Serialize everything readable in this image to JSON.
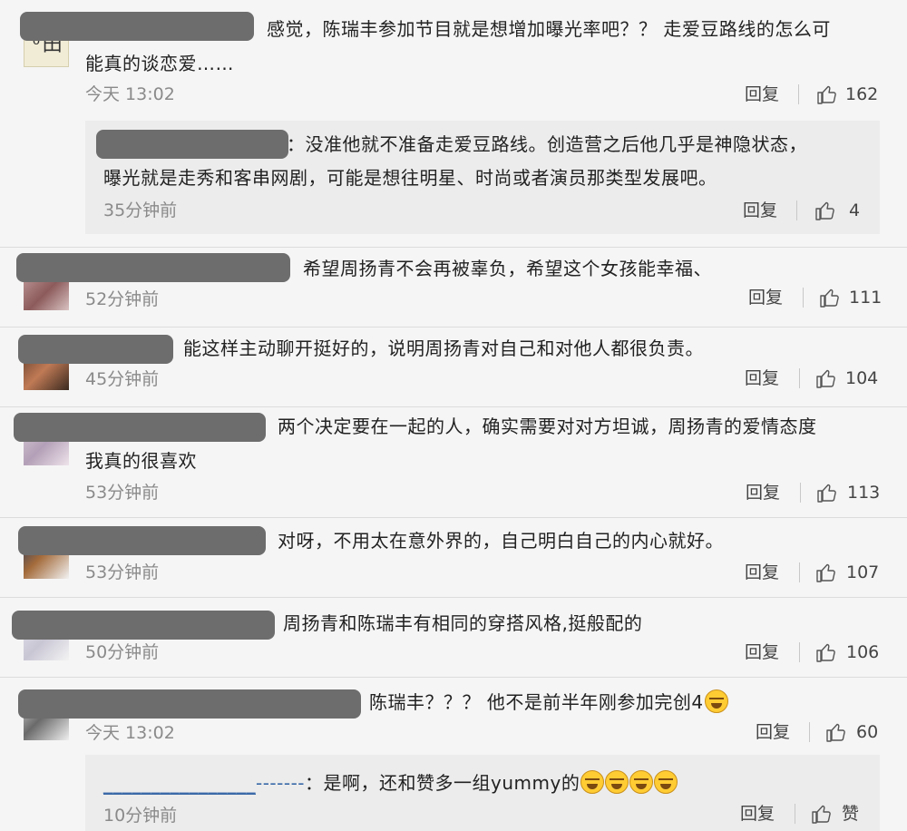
{
  "comments": [
    {
      "text_line1": "感觉，陈瑞丰参加节目就是想增加曝光率吧？？ 走爱豆路线的怎么可",
      "text_line2": "能真的谈恋爱……",
      "time": "今天 13:02",
      "reply": "回复",
      "likes": "162",
      "avatar_text": "ᴼ田"
    },
    {
      "text": "希望周扬青不会再被辜负，希望这个女孩能幸福、",
      "time": "52分钟前",
      "reply": "回复",
      "likes": "111"
    },
    {
      "text": "能这样主动聊开挺好的，说明周扬青对自己和对他人都很负责。",
      "time": "45分钟前",
      "reply": "回复",
      "likes": "104"
    },
    {
      "text_line1": "两个决定要在一起的人，确实需要对对方坦诚，周扬青的爱情态度",
      "text_line2": "我真的很喜欢",
      "time": "53分钟前",
      "reply": "回复",
      "likes": "113"
    },
    {
      "text": "对呀，不用太在意外界的，自己明白自己的内心就好。",
      "time": "53分钟前",
      "reply": "回复",
      "likes": "107"
    },
    {
      "text": "周扬青和陈瑞丰有相同的穿搭风格,挺般配的",
      "time": "50分钟前",
      "reply": "回复",
      "likes": "106"
    },
    {
      "text": "陈瑞丰？？？ 他不是前半年刚参加完创4",
      "time": "今天 13:02",
      "reply": "回复",
      "likes": "60"
    }
  ],
  "sub_replies": [
    {
      "text_line1": "：没准他就不准备走爱豆路线。创造营之后他几乎是神隐状态，",
      "text_line2": "曝光就是走秀和客串网剧，可能是想往明星、时尚或者演员那类型发展吧。",
      "time": "35分钟前",
      "reply": "回复",
      "likes": "4"
    },
    {
      "name_link": "________________",
      "dashes": "-------",
      "text": "：是啊，还和赞多一组yummy的",
      "time": "10分钟前",
      "reply": "回复",
      "like_label": "赞"
    }
  ],
  "colors": {
    "name_redaction": "#6d6d6d",
    "link": "#3a6aa8",
    "meta": "#8a8a8a"
  },
  "icons": [
    "thumbs-up-icon",
    "laughing-tears-emoji"
  ]
}
